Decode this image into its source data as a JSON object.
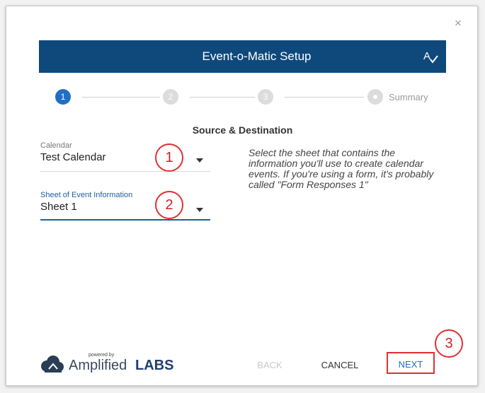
{
  "dialog": {
    "close_label": "×",
    "header_title": "Event-o-Matic Setup",
    "stepper": {
      "steps": [
        "1",
        "2",
        "3"
      ],
      "summary_label": "Summary"
    },
    "section_title": "Source & Destination",
    "fields": {
      "calendar": {
        "label": "Calendar",
        "value": "Test Calendar"
      },
      "sheet": {
        "label": "Sheet of Event Information",
        "value": "Sheet 1"
      }
    },
    "help_text": "Select the sheet that contains the information you'll use to create calendar events. If you're using a form, it's probably called \"Form Responses 1\"",
    "annotations": [
      "1",
      "2",
      "3"
    ],
    "logo": {
      "powered_by": "powered by",
      "amplified": "Amplified",
      "labs": "LABS"
    },
    "buttons": {
      "back": "BACK",
      "cancel": "CANCEL",
      "next": "NEXT"
    }
  },
  "colors": {
    "header_bg": "#0f497c",
    "active_step": "#1f6fc6",
    "annotation": "#e03030"
  }
}
